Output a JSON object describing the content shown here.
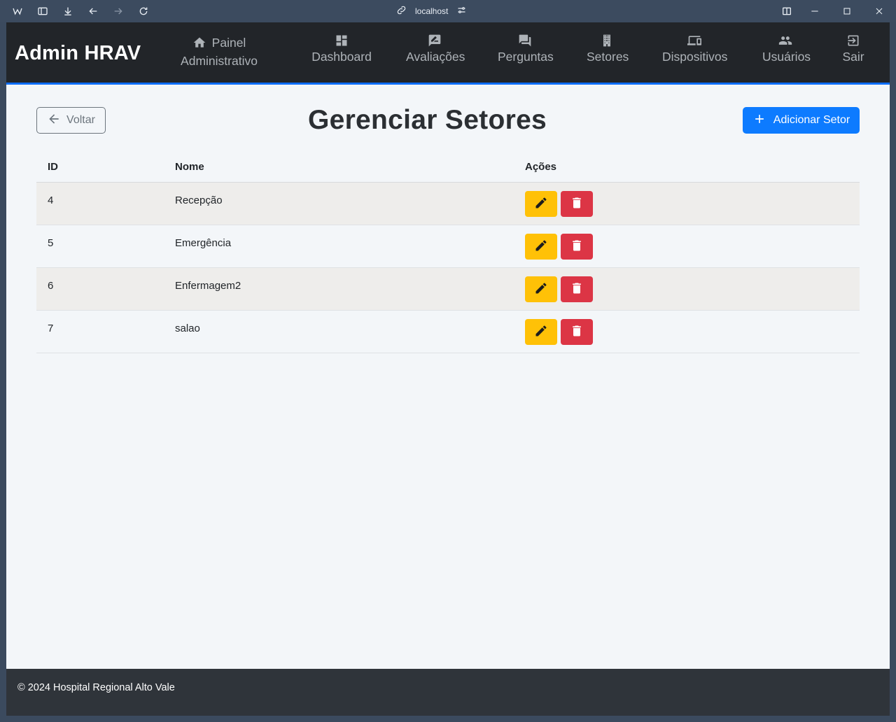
{
  "browser": {
    "url": "localhost"
  },
  "navbar": {
    "brand": "Admin HRAV",
    "items": [
      {
        "label_line1": "Painel",
        "label_line2": "Administrativo",
        "icon": "home-icon"
      },
      {
        "label": "Dashboard",
        "icon": "dashboard-icon"
      },
      {
        "label": "Avaliações",
        "icon": "rate-review-icon"
      },
      {
        "label": "Perguntas",
        "icon": "forum-icon"
      },
      {
        "label": "Setores",
        "icon": "business-icon"
      },
      {
        "label": "Dispositivos",
        "icon": "devices-icon"
      },
      {
        "label": "Usuários",
        "icon": "people-icon"
      },
      {
        "label": "Sair",
        "icon": "exit-icon"
      }
    ]
  },
  "main": {
    "back_label": "Voltar",
    "title": "Gerenciar Setores",
    "add_label": "Adicionar Setor",
    "table": {
      "headers": [
        "ID",
        "Nome",
        "Ações"
      ],
      "rows": [
        {
          "id": "4",
          "nome": "Recepção"
        },
        {
          "id": "5",
          "nome": "Emergência"
        },
        {
          "id": "6",
          "nome": "Enfermagem2"
        },
        {
          "id": "7",
          "nome": "salao"
        }
      ]
    }
  },
  "footer": {
    "text": "© 2024 Hospital Regional Alto Vale"
  },
  "colors": {
    "navbar_bg": "#222529",
    "accent": "#0d6efd",
    "edit_button": "#ffc107",
    "delete_button": "#dc3545",
    "add_button": "#0d7bff",
    "footer_bg": "#2f343a"
  }
}
